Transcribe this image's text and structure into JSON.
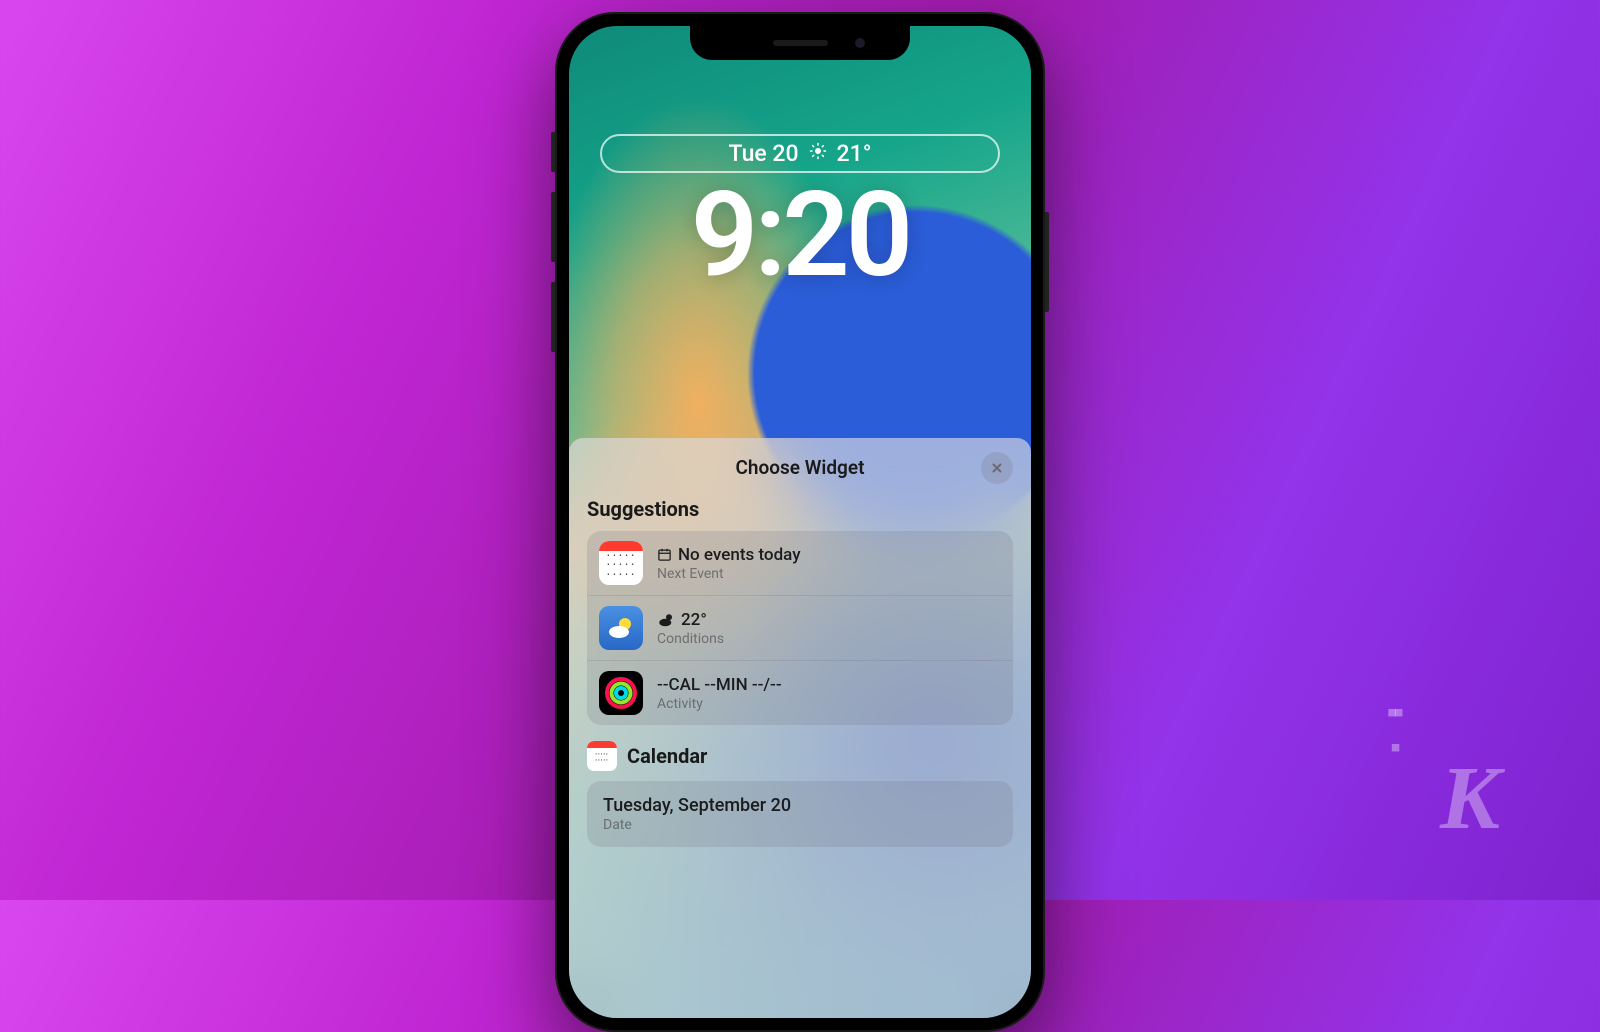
{
  "lockscreen": {
    "date": "Tue 20",
    "temp": "21°",
    "time": "9:20"
  },
  "sheet": {
    "title": "Choose Widget",
    "suggestions_label": "Suggestions",
    "suggestions": [
      {
        "title": "No events today",
        "subtitle": "Next Event"
      },
      {
        "title": "22°",
        "subtitle": "Conditions"
      },
      {
        "title": "--CAL --MIN --/--",
        "subtitle": "Activity"
      }
    ],
    "calendar_label": "Calendar",
    "calendar_items": [
      {
        "title": "Tuesday, September 20",
        "subtitle": "Date"
      }
    ]
  },
  "watermark": "K"
}
